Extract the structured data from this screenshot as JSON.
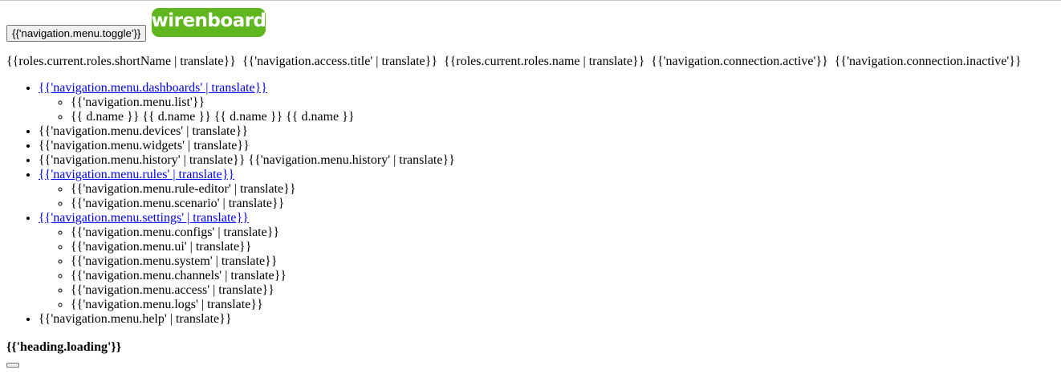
{
  "header": {
    "menu_toggle_label": "{{'navigation.menu.toggle'}}",
    "logo_text": "wirenboard",
    "logo_color": "#5fb61e"
  },
  "status": {
    "role_short": "{{roles.current.roles.shortName | translate}}",
    "access_title": "{{'navigation.access.title' | translate}}",
    "role_name": "{{roles.current.roles.name | translate}}",
    "connection_active": "{{'navigation.connection.active'}}",
    "connection_inactive": "{{'navigation.connection.inactive'}}"
  },
  "menu": {
    "dashboards": "{{'navigation.menu.dashboards' | translate}}",
    "dashboards_list": "{{'navigation.menu.list'}}",
    "dashboard_names": [
      "{{ d.name }}",
      "{{ d.name }}",
      "{{ d.name }}",
      "{{ d.name }}"
    ],
    "devices": "{{'navigation.menu.devices' | translate}}",
    "widgets": "{{'navigation.menu.widgets' | translate}}",
    "history": [
      "{{'navigation.menu.history' | translate}}",
      "{{'navigation.menu.history' | translate}}"
    ],
    "rules": "{{'navigation.menu.rules' | translate}}",
    "rule_editor": "{{'navigation.menu.rule-editor' | translate}}",
    "scenario": "{{'navigation.menu.scenario' | translate}}",
    "settings": "{{'navigation.menu.settings' | translate}}",
    "configs": "{{'navigation.menu.configs' | translate}}",
    "ui": "{{'navigation.menu.ui' | translate}}",
    "system": "{{'navigation.menu.system' | translate}}",
    "channels": "{{'navigation.menu.channels' | translate}}",
    "access": "{{'navigation.menu.access' | translate}}",
    "logs": "{{'navigation.menu.logs' | translate}}",
    "help": "{{'navigation.menu.help' | translate}}",
    "link_color": "#0000ee"
  },
  "main": {
    "heading": "{{'heading.loading'}}"
  }
}
